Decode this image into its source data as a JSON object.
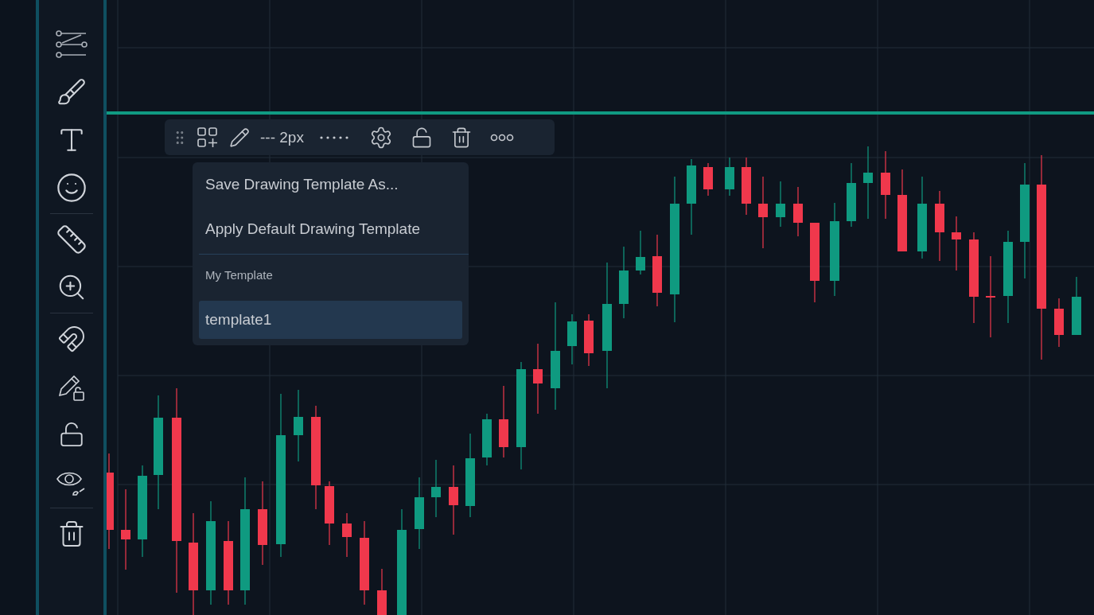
{
  "drawing_toolbar": {
    "line_style": "--- 2px"
  },
  "template_menu": {
    "actions": [
      "Save Drawing Template As...",
      "Apply Default Drawing Template"
    ],
    "section_label": "My Template",
    "templates": [
      {
        "label": "template1",
        "selected": true
      }
    ]
  }
}
